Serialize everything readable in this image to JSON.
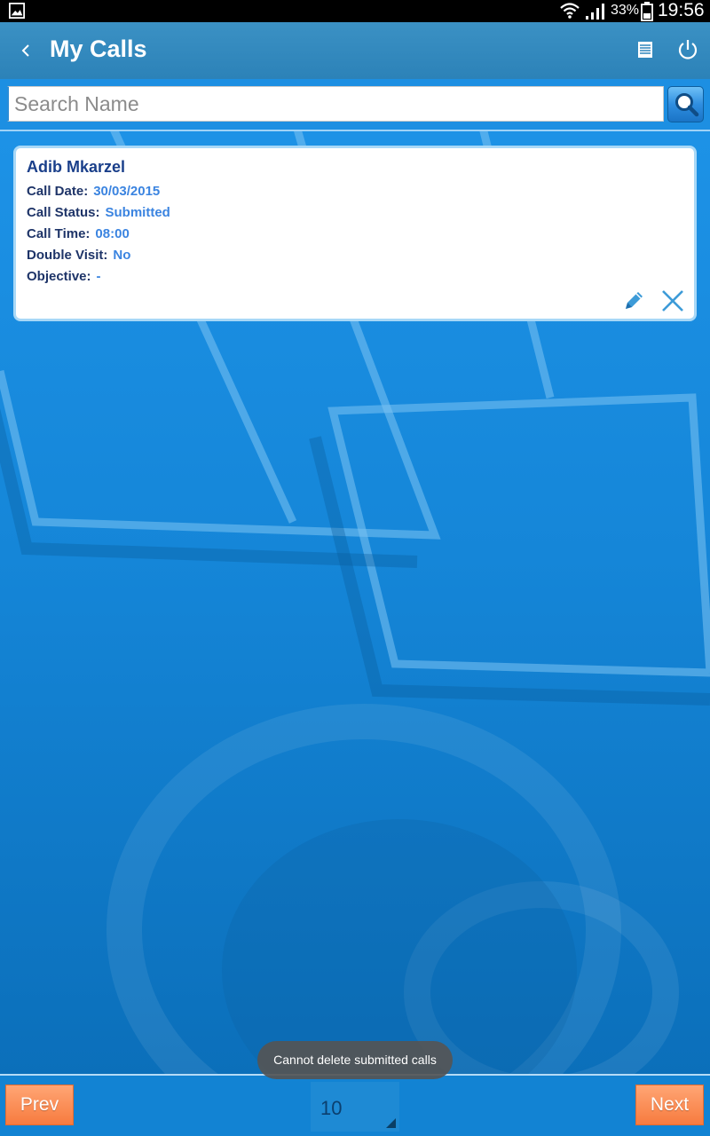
{
  "status_bar": {
    "battery_percent": "33%",
    "time": "19:56"
  },
  "app_bar": {
    "title": "My Calls"
  },
  "search": {
    "placeholder": "Search Name",
    "value": ""
  },
  "calls": [
    {
      "name": "Adib Mkarzel",
      "fields": [
        {
          "label": "Call Date:",
          "value": "30/03/2015"
        },
        {
          "label": "Call Status:",
          "value": "Submitted"
        },
        {
          "label": "Call Time:",
          "value": "08:00"
        },
        {
          "label": "Double Visit:",
          "value": "No"
        },
        {
          "label": "Objective:",
          "value": "-"
        }
      ]
    }
  ],
  "pagination": {
    "prev_label": "Prev",
    "next_label": "Next",
    "page_size": "10"
  },
  "toast": {
    "message": "Cannot delete submitted calls"
  },
  "colors": {
    "app_bar": "#2f87bd",
    "background": "#1586d8",
    "card_name": "#1a3f8a",
    "field_value": "#3b84e0",
    "nav_button": "#f7853f"
  }
}
